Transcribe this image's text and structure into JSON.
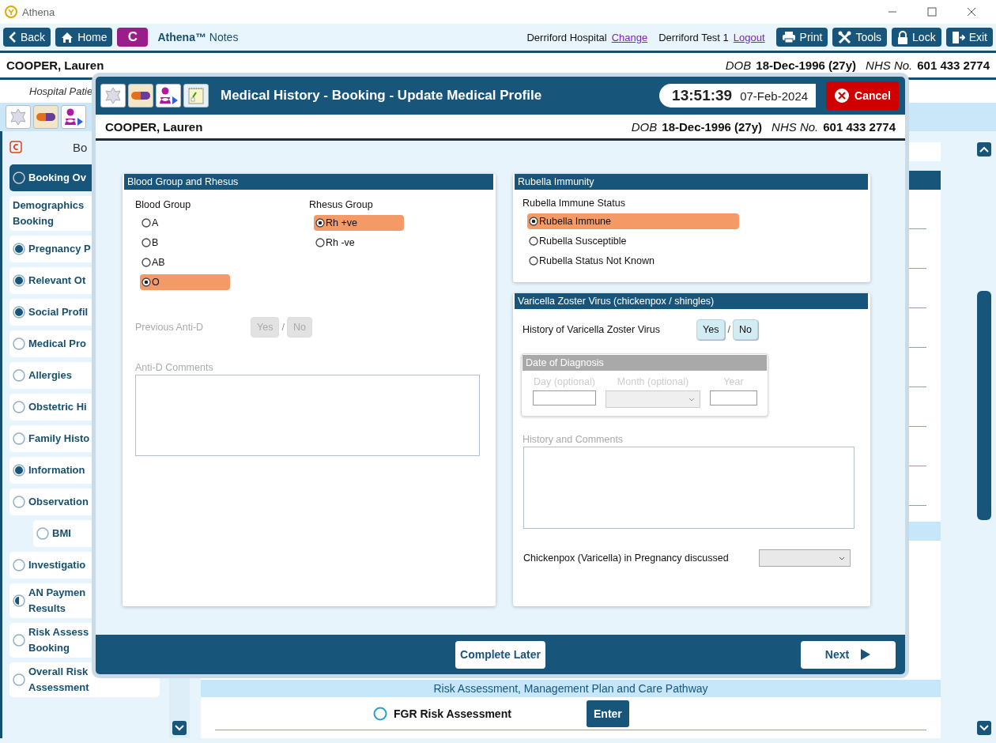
{
  "window": {
    "title": "Athena"
  },
  "toolbar": {
    "back": "Back",
    "home": "Home",
    "badge": "C",
    "brand": "Athena™",
    "brand_suffix": "Notes",
    "site": "Derriford Hospital",
    "site_link": "Change",
    "user": "Derriford Test 1",
    "user_link": "Logout",
    "actions": [
      "Print",
      "Tools",
      "Lock",
      "Exit"
    ]
  },
  "patient": {
    "name": "COOPER, Lauren",
    "dob_label": "DOB",
    "dob": "18-Dec-1996 (27y)",
    "nhs_label": "NHS No.",
    "nhs": "601 433 2774"
  },
  "subheader": "Hospital Patie",
  "sidebar": {
    "heading": "Bo",
    "items": [
      {
        "label": "Booking Ov",
        "kind": "status",
        "complete": false,
        "started": false,
        "selected": true
      },
      {
        "label": "Demographics\nBooking",
        "kind": "plain",
        "selected": false
      },
      {
        "label": "Pregnancy P",
        "kind": "status",
        "complete": true,
        "started": true,
        "selected": false
      },
      {
        "label": "Relevant Ot",
        "kind": "status",
        "complete": true,
        "started": true,
        "selected": false
      },
      {
        "label": "Social Profil",
        "kind": "status",
        "complete": true,
        "started": true,
        "selected": false
      },
      {
        "label": "Medical Pro",
        "kind": "status",
        "complete": false,
        "started": false,
        "selected": false
      },
      {
        "label": "Allergies",
        "kind": "status",
        "complete": false,
        "started": false,
        "selected": false
      },
      {
        "label": "Obstetric Hi",
        "kind": "status",
        "complete": false,
        "started": false,
        "selected": false
      },
      {
        "label": "Family Histo",
        "kind": "status",
        "complete": false,
        "started": false,
        "selected": false
      },
      {
        "label": "Information",
        "kind": "status",
        "complete": true,
        "started": true,
        "selected": false
      },
      {
        "label": "Observation",
        "kind": "status",
        "complete": false,
        "started": false,
        "selected": false,
        "children": [
          {
            "label": "BMI",
            "kind": "status",
            "complete": false,
            "started": false,
            "selected": false
          }
        ]
      },
      {
        "label": "Investigatio",
        "kind": "status",
        "complete": false,
        "started": false,
        "selected": false
      },
      {
        "label": "AN Paymen\nResults",
        "kind": "status",
        "complete": false,
        "started": true,
        "selected": false
      },
      {
        "label": "Risk Assess\nBooking",
        "kind": "status",
        "complete": false,
        "started": false,
        "selected": false
      },
      {
        "label": "Overall Risk\nAssessment",
        "kind": "status",
        "complete": false,
        "started": false,
        "selected": false
      }
    ]
  },
  "main": {
    "band": "Risk Assessment, Management Plan and Care Pathway",
    "rows": [
      {
        "label": "FGR Risk Assessment",
        "button": "Enter"
      }
    ]
  },
  "dialog": {
    "title": "Medical History - Booking - Update Medical Profile",
    "time": "13:51:39",
    "date": "07-Feb-2024",
    "cancel": "Cancel",
    "patient": {
      "name": "COOPER, Lauren",
      "dob_label": "DOB",
      "dob": "18-Dec-1996 (27y)",
      "nhs_label": "NHS No.",
      "nhs": "601 433 2774"
    },
    "blood_card": {
      "title": "Blood Group and Rhesus",
      "blood_group": {
        "label": "Blood Group",
        "options": [
          {
            "label": "A",
            "selected": false
          },
          {
            "label": "B",
            "selected": false
          },
          {
            "label": "AB",
            "selected": false
          },
          {
            "label": "O",
            "selected": true
          }
        ]
      },
      "rhesus": {
        "label": "Rhesus Group",
        "options": [
          {
            "label": "Rh +ve",
            "selected": true
          },
          {
            "label": "Rh -ve",
            "selected": false
          }
        ]
      },
      "previous_anti_d": {
        "label": "Previous Anti-D",
        "yes": "Yes",
        "separator": "/",
        "no": "No",
        "disabled": true
      },
      "anti_d_comments": {
        "label": "Anti-D Comments",
        "disabled": true
      }
    },
    "rubella_card": {
      "title": "Rubella Immunity",
      "label": "Rubella Immune Status",
      "options": [
        {
          "label": "Rubella Immune",
          "selected": true
        },
        {
          "label": "Rubella Susceptible",
          "selected": false
        },
        {
          "label": "Rubella Status Not Known",
          "selected": false
        }
      ]
    },
    "varicella_card": {
      "title": "Varicella Zoster Virus (chickenpox / shingles)",
      "history": {
        "label": "History of Varicella Zoster Virus",
        "yes": "Yes",
        "separator": "/",
        "no": "No",
        "disabled": false
      },
      "date_of_diagnosis": {
        "title": "Date of Diagnosis",
        "day": "Day (optional)",
        "month": "Month (optional)",
        "year": "Year",
        "disabled": true
      },
      "comments": {
        "label": "History and Comments",
        "disabled": true
      },
      "discussed": {
        "label": "Chickenpox (Varicella) in Pregnancy discussed"
      }
    },
    "complete_later": "Complete Later",
    "next": "Next"
  }
}
